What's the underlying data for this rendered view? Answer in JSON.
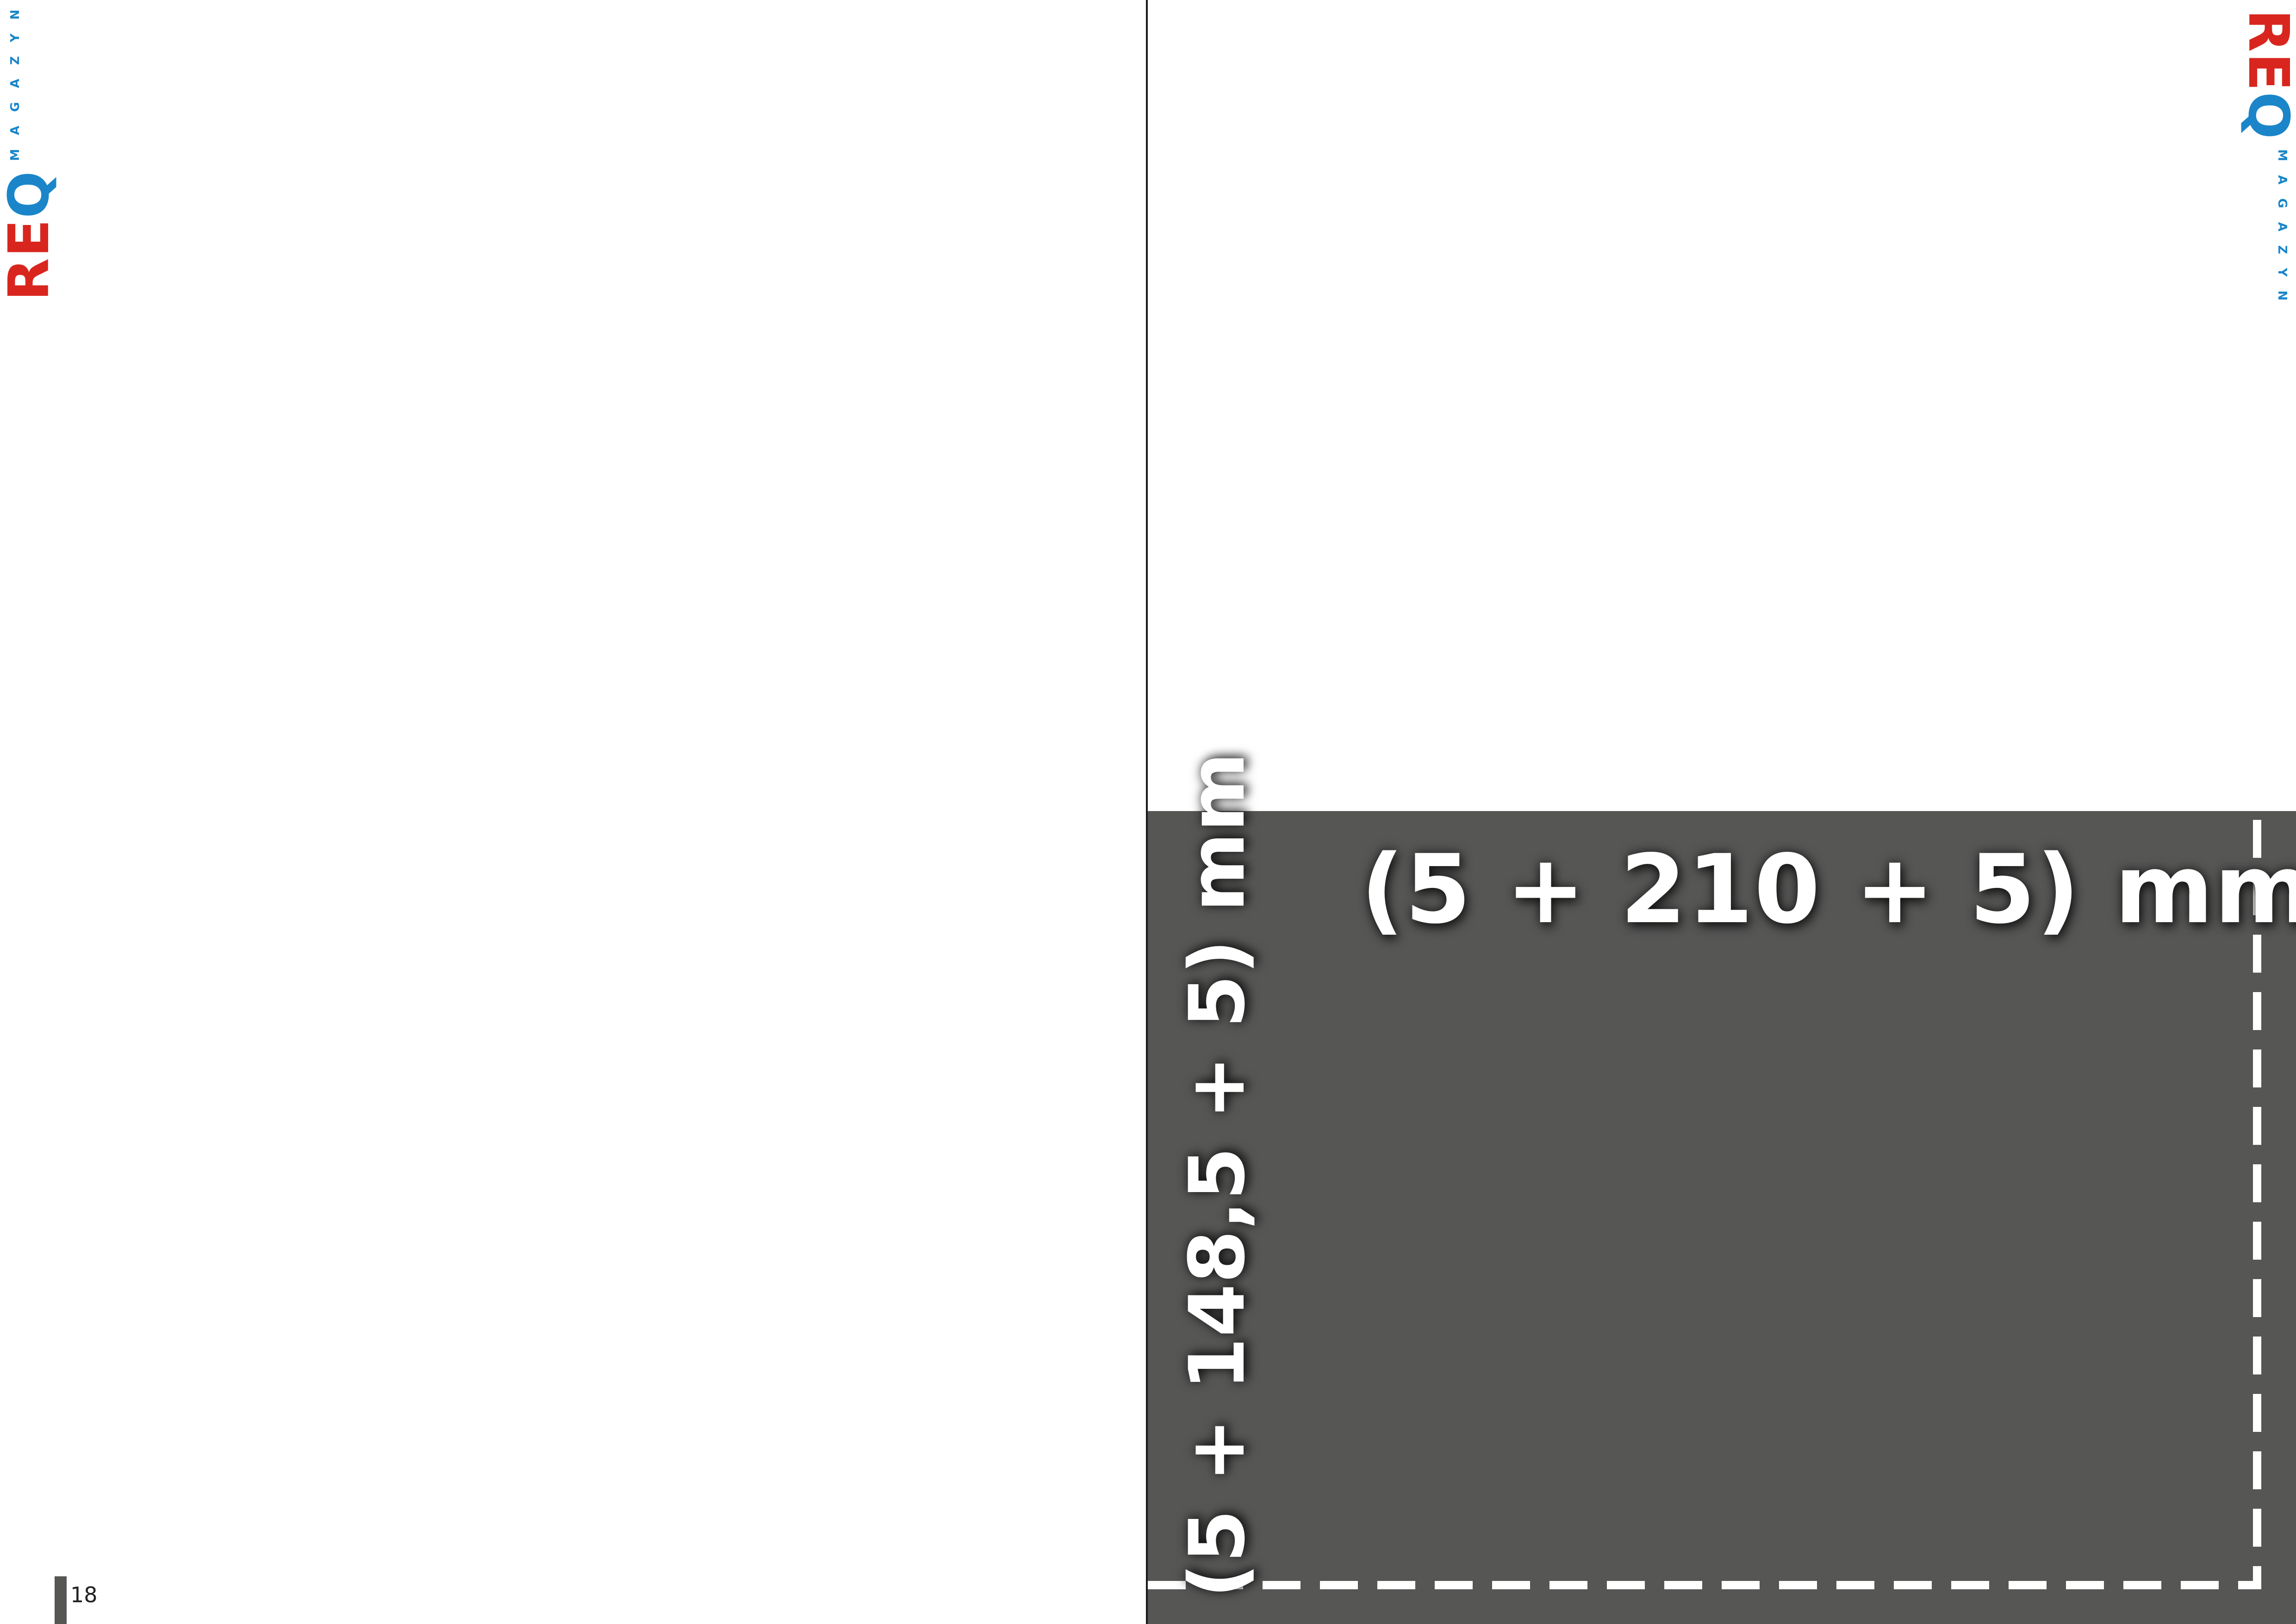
{
  "brand": {
    "logo_primary": "REQ",
    "logo_secondary": "MAGAZYN",
    "colors": {
      "red": "#d8261e",
      "blue": "#1a86c9"
    }
  },
  "page": {
    "number": "18"
  },
  "ad_placeholder": {
    "width_label": "(5 + 210 + 5) mm",
    "height_label": "(5 + 148,5  + 5) mm",
    "fill_color": "#565655",
    "trim_line_style": "dashed white"
  }
}
